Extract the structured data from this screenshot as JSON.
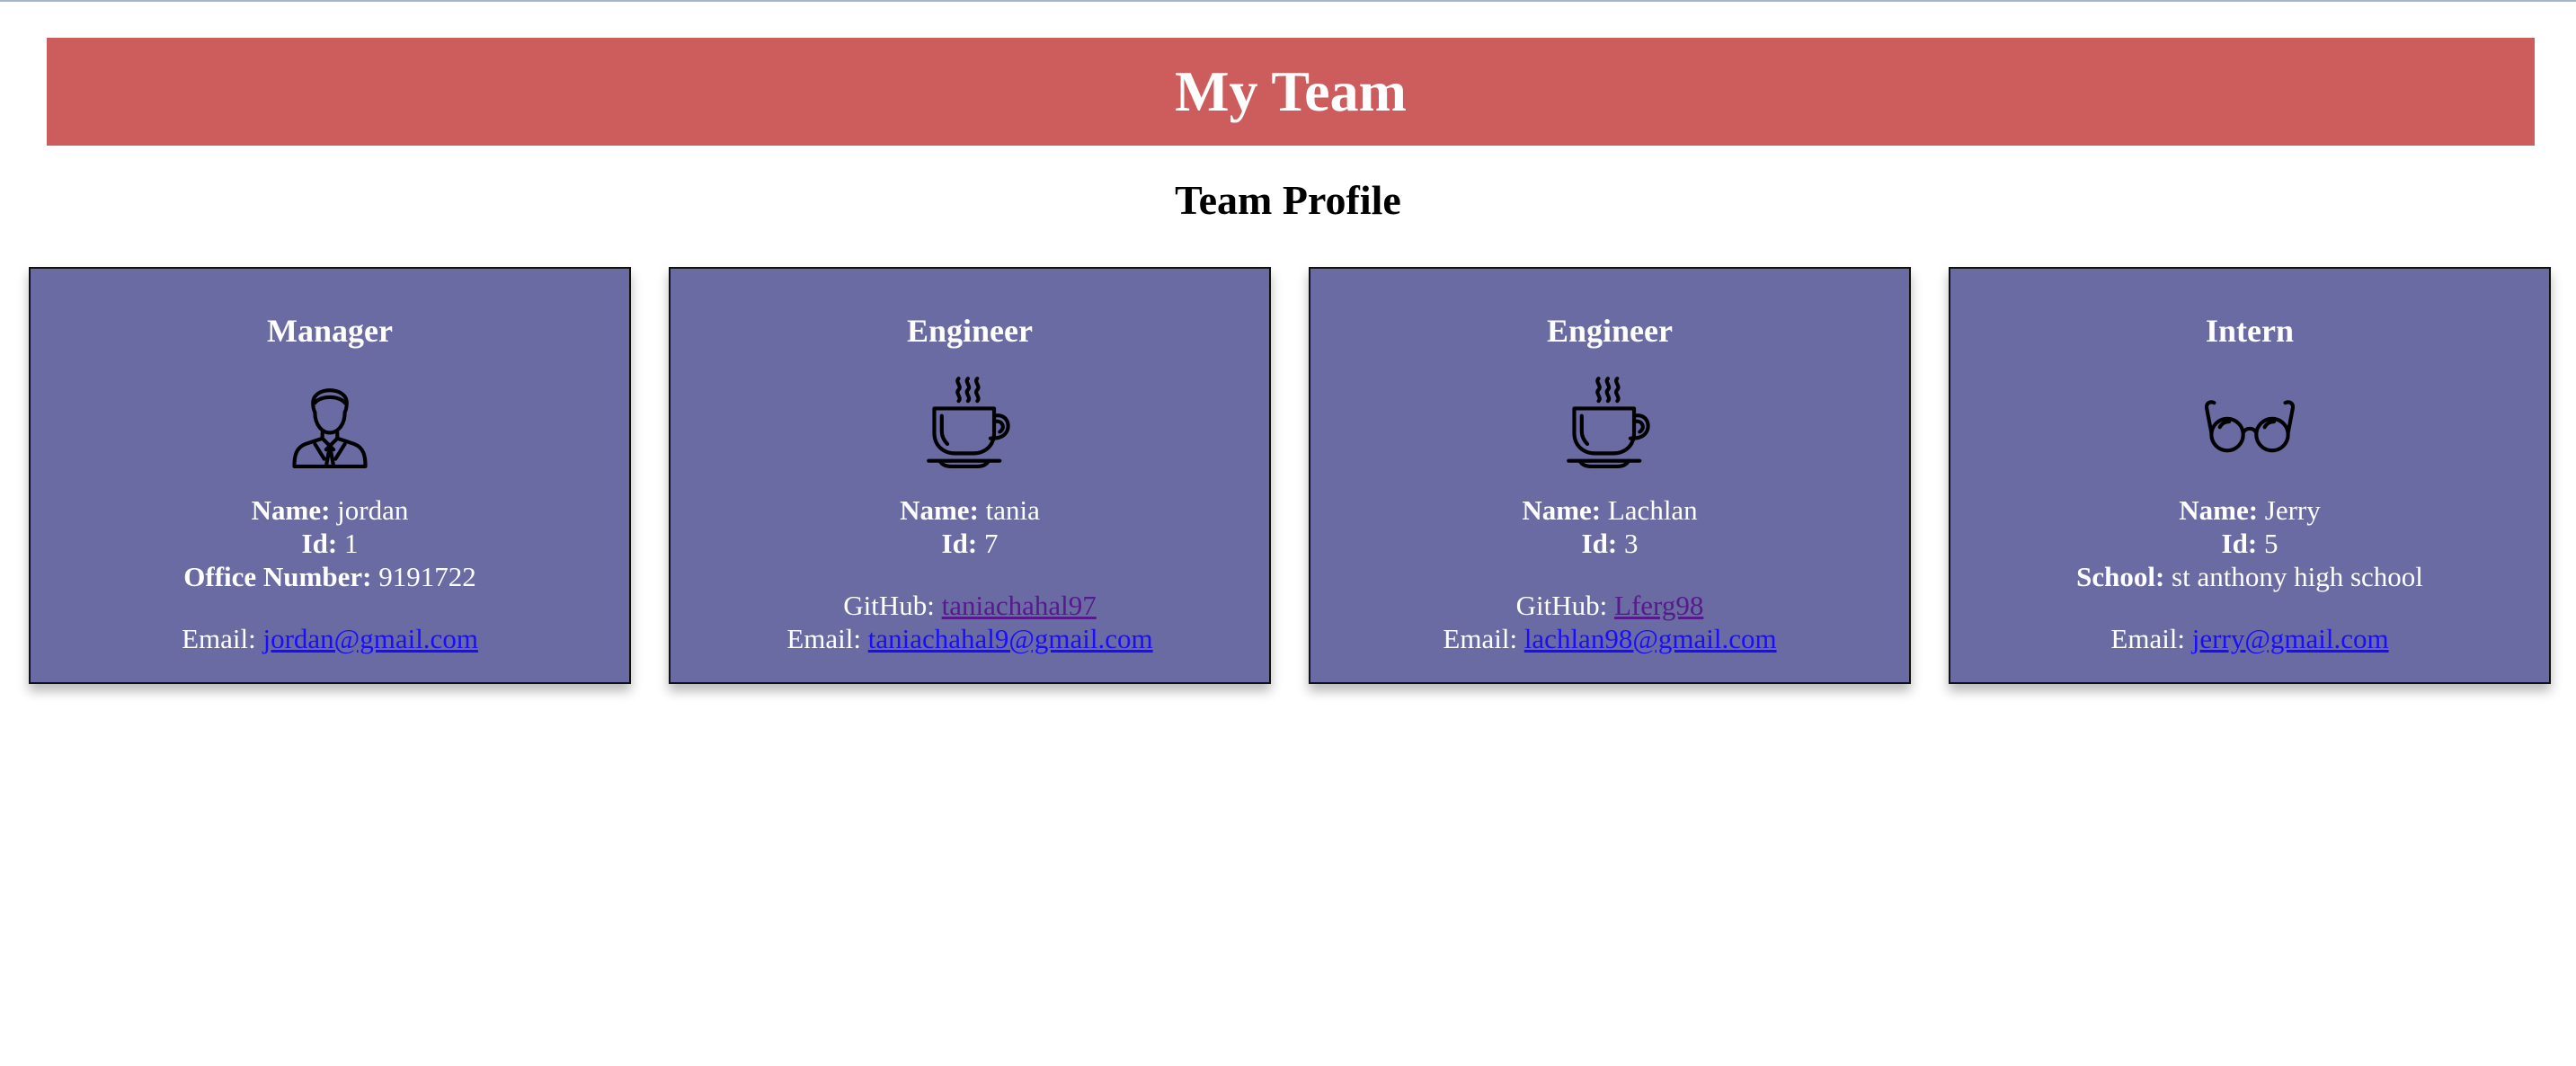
{
  "header": {
    "title": "My Team"
  },
  "section": {
    "title": "Team Profile"
  },
  "labels": {
    "name": "Name:",
    "id": "Id:",
    "office": "Office Number:",
    "school": "School:",
    "github": "GitHub:",
    "email": "Email:"
  },
  "colors": {
    "banner": "#cd5c5c",
    "card": "#6a6ba2",
    "email_link": "#1a0dff",
    "github_link": "#551a8b"
  },
  "cards": [
    {
      "role": "Manager",
      "icon": "manager-icon",
      "name": "jordan",
      "id": "1",
      "office_number": "9191722",
      "email": "jordan@gmail.com"
    },
    {
      "role": "Engineer",
      "icon": "coffee-cup-icon",
      "name": "tania",
      "id": "7",
      "github": "taniachahal97",
      "email": "taniachahal9@gmail.com"
    },
    {
      "role": "Engineer",
      "icon": "coffee-cup-icon",
      "name": "Lachlan",
      "id": "3",
      "github": "Lferg98",
      "email": "lachlan98@gmail.com"
    },
    {
      "role": "Intern",
      "icon": "glasses-icon",
      "name": "Jerry",
      "id": "5",
      "school": "st anthony high school",
      "email": "jerry@gmail.com"
    }
  ]
}
